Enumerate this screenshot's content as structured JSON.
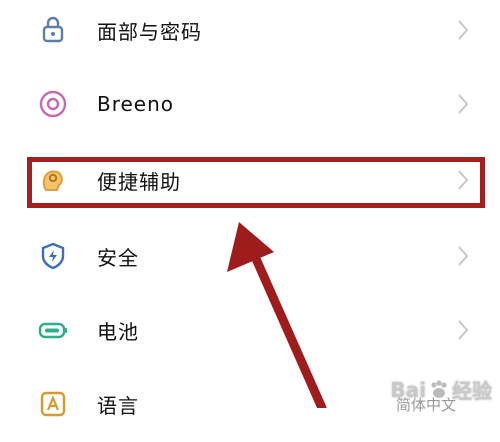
{
  "settings": {
    "items": [
      {
        "label": "面部与密码",
        "icon": "lock-icon",
        "color": "#5b7fa8"
      },
      {
        "label": "Breeno",
        "icon": "breeno-icon",
        "color": "#c86bb0"
      },
      {
        "label": "便捷辅助",
        "icon": "assist-hand-icon",
        "color": "#e0a040"
      },
      {
        "label": "安全",
        "icon": "shield-icon",
        "color": "#3d6fb8"
      },
      {
        "label": "电池",
        "icon": "battery-icon",
        "color": "#2fae8a"
      },
      {
        "label": "语言",
        "icon": "language-icon",
        "color": "#d89a2c",
        "value": "简体中文"
      }
    ]
  },
  "annotation": {
    "highlight_color": "#a81f1f",
    "arrow_color": "#9e1c1c"
  },
  "watermark": {
    "text_left": "Bai",
    "text_right": "经验"
  }
}
